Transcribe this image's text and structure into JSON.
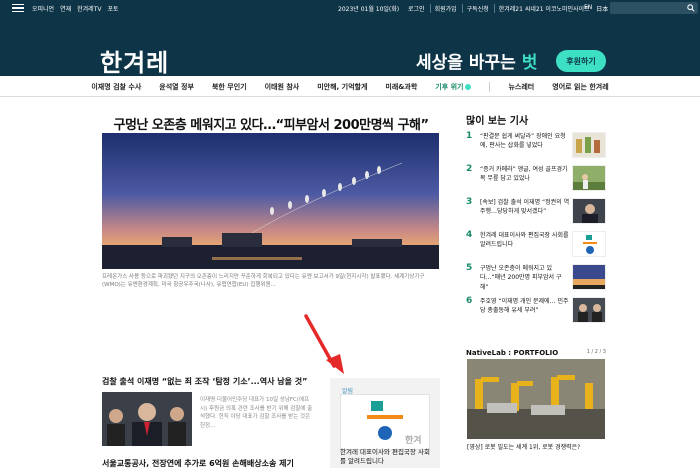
{
  "topbar": {
    "links": [
      "오피니언",
      "연재",
      "한겨레TV",
      "포토"
    ],
    "date": "2023년 01월 10일(화)",
    "right_links": [
      "로그인",
      "회원가입",
      "구독신청",
      "한겨레21 씨네21 이코노미인사이트"
    ],
    "lang": [
      "EN",
      "日本",
      "中文"
    ]
  },
  "header": {
    "logo": "한겨레",
    "slogan_pre": "세상을 바꾸는 ",
    "slogan_hl": "벗",
    "support_label": "후원하기"
  },
  "nav": {
    "items": [
      "이재명 검찰 수사",
      "윤석열 정부",
      "북한 무인기",
      "이태원 참사",
      "미안해, 기억할게",
      "미래&과학",
      "기후 위기",
      "뉴스레터",
      "영어로 읽는 한겨레"
    ]
  },
  "main": {
    "headline": "구멍난 오존층 메워지고 있다…“피부암서 200만명씩 구해”",
    "caption": "프레온가스 사용 등으로 파괴됐던 지구의 오존층이 느리지만 꾸준하게 회복되고 있다는 유엔 보고서가 9일(현지시각) 발표됐다. 세계기상기구(WMO)는 유엔환경계획, 미국 항공우주국(나사), 유럽연합(EU) 집행위원...",
    "sub_headline": "검찰 출석 이재명 “없는 죄 조작 ‘탐정 기소’...역사 남을 것”",
    "sub_desc": "이재명 더불어민주당 대표가 10일 성남FC(에프시) 후원금 의혹 관련 조사를 받기 위해 검찰에 출석했다. 현직 야당 대표가 검찰 조사를 받는 것은 헌정...",
    "bottom_headline": "서울교통공사, 전장연에 추가로 6억원 손해배상소송 제기",
    "ad_tag": "알림",
    "ad_title": "한겨레 대표이사와 편집국장 사회를 알려드립니다"
  },
  "sidebar": {
    "title": "많이 보는 기사",
    "items": [
      {
        "rank": "1",
        "text": "“판결문 쉽게 써달라” 장애인 요청에, 판사는 삽화를 넣었다"
      },
      {
        "rank": "2",
        "text": "“증거 카메라” 앵글, 여성 골프경기복 무릎 담고 있었나"
      },
      {
        "rank": "3",
        "text": "[속보] 검찰 출석 이재명 “정권의 역주행…당당하게 맞서겠다”"
      },
      {
        "rank": "4",
        "text": "한겨레 대표이사와 편집국장 사회를 알려드립니다"
      },
      {
        "rank": "5",
        "text": "구멍난 오존층이 메워지고 있다…“매년 200만명 피부암서 구해”"
      },
      {
        "rank": "6",
        "text": "주호영 “이재명 개인 문제에… 민주당 총출동해 유세 부려”"
      }
    ],
    "native_title": "NativeLab : PORTFOLIO",
    "native_pager": "1 / 2 / 3",
    "native_caption": "[영상] 로봇 밀도는 세계 1위, 로봇 경쟁력은?"
  },
  "colors": {
    "brand_dark": "#0e3447",
    "accent_mint": "#3de0c3",
    "rank_green": "#1a8a6a"
  }
}
